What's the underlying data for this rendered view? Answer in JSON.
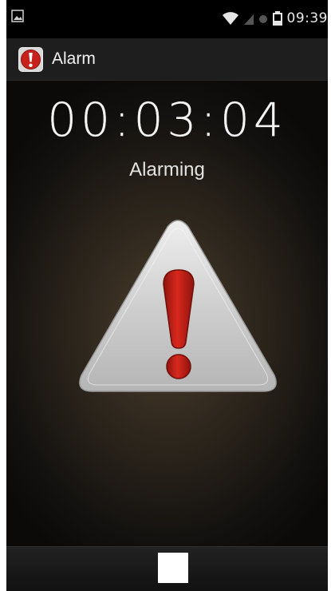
{
  "status_bar": {
    "time": "09:39",
    "left_icon": "gallery-notification-icon",
    "icons": [
      "wifi-icon",
      "cellular-signal-icon",
      "alarm-dot-icon",
      "battery-icon"
    ]
  },
  "action_bar": {
    "app_icon": "alarm-app-icon",
    "title": "Alarm"
  },
  "main": {
    "timer": "00:03:04",
    "status": "Alarming",
    "graphic": "warning-triangle-icon"
  },
  "bottom_bar": {
    "stop_button_icon": "stop-icon"
  },
  "colors": {
    "exclamation_red": "#c0221a",
    "triangle_silver": "#d4d4d4",
    "background_glow": "#4b3d2c"
  }
}
